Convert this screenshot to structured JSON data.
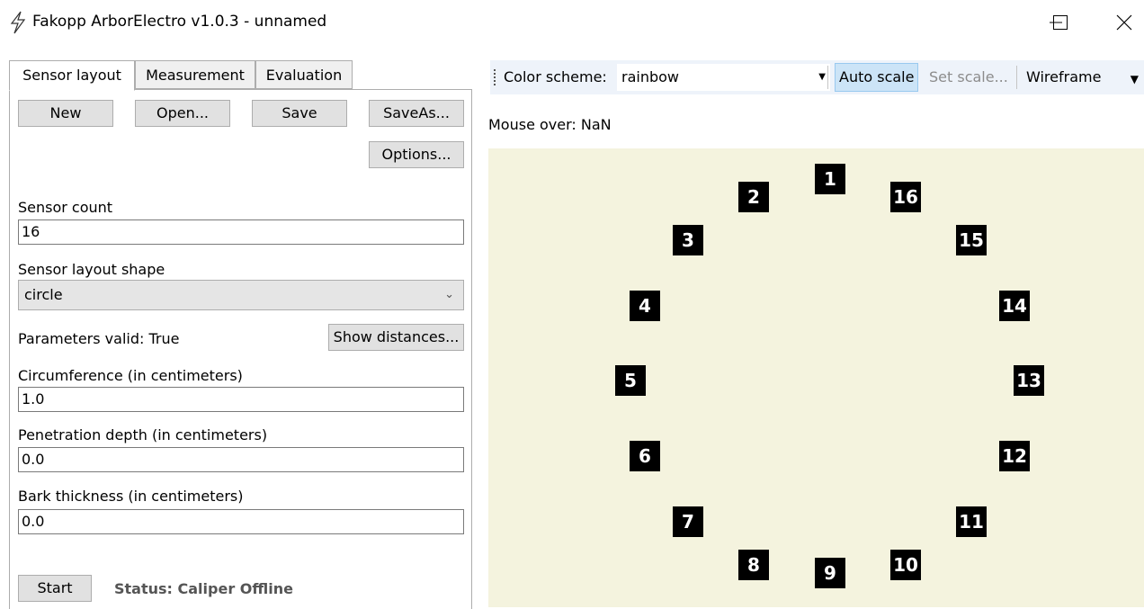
{
  "window": {
    "title": "Fakopp ArborElectro v1.0.3 - unnamed",
    "controls": [
      "minimize",
      "maximize",
      "close"
    ]
  },
  "tabs": [
    {
      "label": "Sensor layout",
      "active": true
    },
    {
      "label": "Measurement",
      "active": false
    },
    {
      "label": "Evaluation",
      "active": false
    }
  ],
  "sensor_layout": {
    "buttons": {
      "new": "New",
      "open": "Open...",
      "save": "Save",
      "save_as": "SaveAs...",
      "options": "Options..."
    },
    "sensor_count": {
      "label": "Sensor count",
      "value": "16"
    },
    "layout_shape": {
      "label": "Sensor layout shape",
      "value": "circle"
    },
    "parameters_valid": "Parameters valid: True",
    "show_distances": "Show distances...",
    "circumference": {
      "label": "Circumference (in centimeters)",
      "value": "1.0"
    },
    "penetration_depth": {
      "label": "Penetration depth (in centimeters)",
      "value": "0.0"
    },
    "bark_thickness": {
      "label": "Bark thickness (in centimeters)",
      "value": "0.0"
    },
    "start": "Start",
    "status": "Status: Caliper Offline"
  },
  "toolbar": {
    "color_scheme_label": "Color scheme:",
    "color_scheme_value": "rainbow",
    "auto_scale": "Auto scale",
    "auto_scale_checked": true,
    "set_scale": "Set scale...",
    "set_scale_enabled": false,
    "wireframe": "Wireframe"
  },
  "mouse_over": "Mouse over: NaN",
  "canvas_background": "#f4f3de",
  "sensors": [
    "1",
    "2",
    "3",
    "4",
    "5",
    "6",
    "7",
    "8",
    "9",
    "10",
    "11",
    "12",
    "13",
    "14",
    "15",
    "16"
  ]
}
